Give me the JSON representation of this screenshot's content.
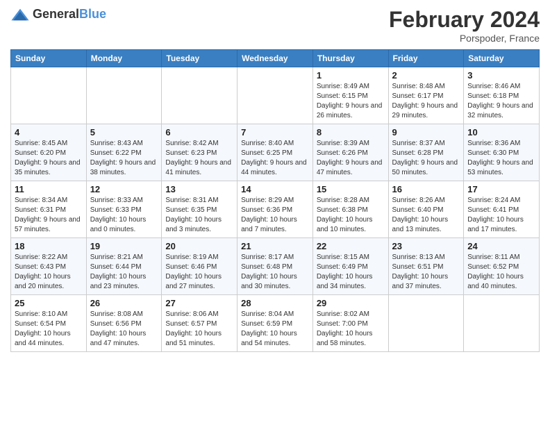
{
  "header": {
    "logo_general": "General",
    "logo_blue": "Blue",
    "title": "February 2024",
    "subtitle": "Porspoder, France"
  },
  "days_of_week": [
    "Sunday",
    "Monday",
    "Tuesday",
    "Wednesday",
    "Thursday",
    "Friday",
    "Saturday"
  ],
  "weeks": [
    [
      {
        "day": "",
        "info": ""
      },
      {
        "day": "",
        "info": ""
      },
      {
        "day": "",
        "info": ""
      },
      {
        "day": "",
        "info": ""
      },
      {
        "day": "1",
        "info": "Sunrise: 8:49 AM\nSunset: 6:15 PM\nDaylight: 9 hours and 26 minutes."
      },
      {
        "day": "2",
        "info": "Sunrise: 8:48 AM\nSunset: 6:17 PM\nDaylight: 9 hours and 29 minutes."
      },
      {
        "day": "3",
        "info": "Sunrise: 8:46 AM\nSunset: 6:18 PM\nDaylight: 9 hours and 32 minutes."
      }
    ],
    [
      {
        "day": "4",
        "info": "Sunrise: 8:45 AM\nSunset: 6:20 PM\nDaylight: 9 hours and 35 minutes."
      },
      {
        "day": "5",
        "info": "Sunrise: 8:43 AM\nSunset: 6:22 PM\nDaylight: 9 hours and 38 minutes."
      },
      {
        "day": "6",
        "info": "Sunrise: 8:42 AM\nSunset: 6:23 PM\nDaylight: 9 hours and 41 minutes."
      },
      {
        "day": "7",
        "info": "Sunrise: 8:40 AM\nSunset: 6:25 PM\nDaylight: 9 hours and 44 minutes."
      },
      {
        "day": "8",
        "info": "Sunrise: 8:39 AM\nSunset: 6:26 PM\nDaylight: 9 hours and 47 minutes."
      },
      {
        "day": "9",
        "info": "Sunrise: 8:37 AM\nSunset: 6:28 PM\nDaylight: 9 hours and 50 minutes."
      },
      {
        "day": "10",
        "info": "Sunrise: 8:36 AM\nSunset: 6:30 PM\nDaylight: 9 hours and 53 minutes."
      }
    ],
    [
      {
        "day": "11",
        "info": "Sunrise: 8:34 AM\nSunset: 6:31 PM\nDaylight: 9 hours and 57 minutes."
      },
      {
        "day": "12",
        "info": "Sunrise: 8:33 AM\nSunset: 6:33 PM\nDaylight: 10 hours and 0 minutes."
      },
      {
        "day": "13",
        "info": "Sunrise: 8:31 AM\nSunset: 6:35 PM\nDaylight: 10 hours and 3 minutes."
      },
      {
        "day": "14",
        "info": "Sunrise: 8:29 AM\nSunset: 6:36 PM\nDaylight: 10 hours and 7 minutes."
      },
      {
        "day": "15",
        "info": "Sunrise: 8:28 AM\nSunset: 6:38 PM\nDaylight: 10 hours and 10 minutes."
      },
      {
        "day": "16",
        "info": "Sunrise: 8:26 AM\nSunset: 6:40 PM\nDaylight: 10 hours and 13 minutes."
      },
      {
        "day": "17",
        "info": "Sunrise: 8:24 AM\nSunset: 6:41 PM\nDaylight: 10 hours and 17 minutes."
      }
    ],
    [
      {
        "day": "18",
        "info": "Sunrise: 8:22 AM\nSunset: 6:43 PM\nDaylight: 10 hours and 20 minutes."
      },
      {
        "day": "19",
        "info": "Sunrise: 8:21 AM\nSunset: 6:44 PM\nDaylight: 10 hours and 23 minutes."
      },
      {
        "day": "20",
        "info": "Sunrise: 8:19 AM\nSunset: 6:46 PM\nDaylight: 10 hours and 27 minutes."
      },
      {
        "day": "21",
        "info": "Sunrise: 8:17 AM\nSunset: 6:48 PM\nDaylight: 10 hours and 30 minutes."
      },
      {
        "day": "22",
        "info": "Sunrise: 8:15 AM\nSunset: 6:49 PM\nDaylight: 10 hours and 34 minutes."
      },
      {
        "day": "23",
        "info": "Sunrise: 8:13 AM\nSunset: 6:51 PM\nDaylight: 10 hours and 37 minutes."
      },
      {
        "day": "24",
        "info": "Sunrise: 8:11 AM\nSunset: 6:52 PM\nDaylight: 10 hours and 40 minutes."
      }
    ],
    [
      {
        "day": "25",
        "info": "Sunrise: 8:10 AM\nSunset: 6:54 PM\nDaylight: 10 hours and 44 minutes."
      },
      {
        "day": "26",
        "info": "Sunrise: 8:08 AM\nSunset: 6:56 PM\nDaylight: 10 hours and 47 minutes."
      },
      {
        "day": "27",
        "info": "Sunrise: 8:06 AM\nSunset: 6:57 PM\nDaylight: 10 hours and 51 minutes."
      },
      {
        "day": "28",
        "info": "Sunrise: 8:04 AM\nSunset: 6:59 PM\nDaylight: 10 hours and 54 minutes."
      },
      {
        "day": "29",
        "info": "Sunrise: 8:02 AM\nSunset: 7:00 PM\nDaylight: 10 hours and 58 minutes."
      },
      {
        "day": "",
        "info": ""
      },
      {
        "day": "",
        "info": ""
      }
    ]
  ]
}
